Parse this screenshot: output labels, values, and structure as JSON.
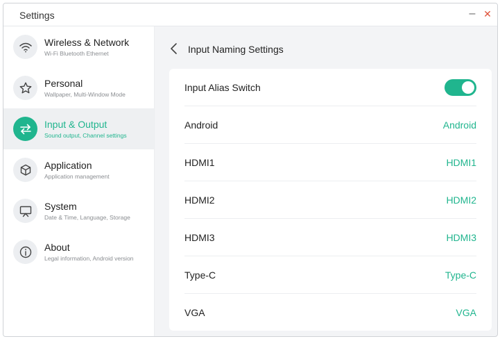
{
  "window": {
    "title": "Settings"
  },
  "sidebar": {
    "items": [
      {
        "label": "Wireless & Network",
        "sub": "Wi-Fi Bluetooth Ethernet",
        "icon": "wifi-icon",
        "active": false
      },
      {
        "label": "Personal",
        "sub": "Wallpaper, Multi-Window Mode",
        "icon": "star-icon",
        "active": false
      },
      {
        "label": "Input & Output",
        "sub": "Sound output, Channel settings",
        "icon": "swap-arrows-icon",
        "active": true
      },
      {
        "label": "Application",
        "sub": "Application management",
        "icon": "cube-icon",
        "active": false
      },
      {
        "label": "System",
        "sub": "Date & Time, Language, Storage",
        "icon": "monitor-icon",
        "active": false
      },
      {
        "label": "About",
        "sub": "Legal information, Android version",
        "icon": "info-icon",
        "active": false
      }
    ]
  },
  "main": {
    "title": "Input Naming Settings",
    "switch": {
      "label": "Input Alias Switch",
      "on": true
    },
    "rows": [
      {
        "label": "Android",
        "value": "Android"
      },
      {
        "label": "HDMI1",
        "value": "HDMI1"
      },
      {
        "label": "HDMI2",
        "value": "HDMI2"
      },
      {
        "label": "HDMI3",
        "value": "HDMI3"
      },
      {
        "label": "Type-C",
        "value": "Type-C"
      },
      {
        "label": "VGA",
        "value": "VGA"
      }
    ]
  },
  "colors": {
    "accent": "#20b58e",
    "close": "#e0533b"
  }
}
